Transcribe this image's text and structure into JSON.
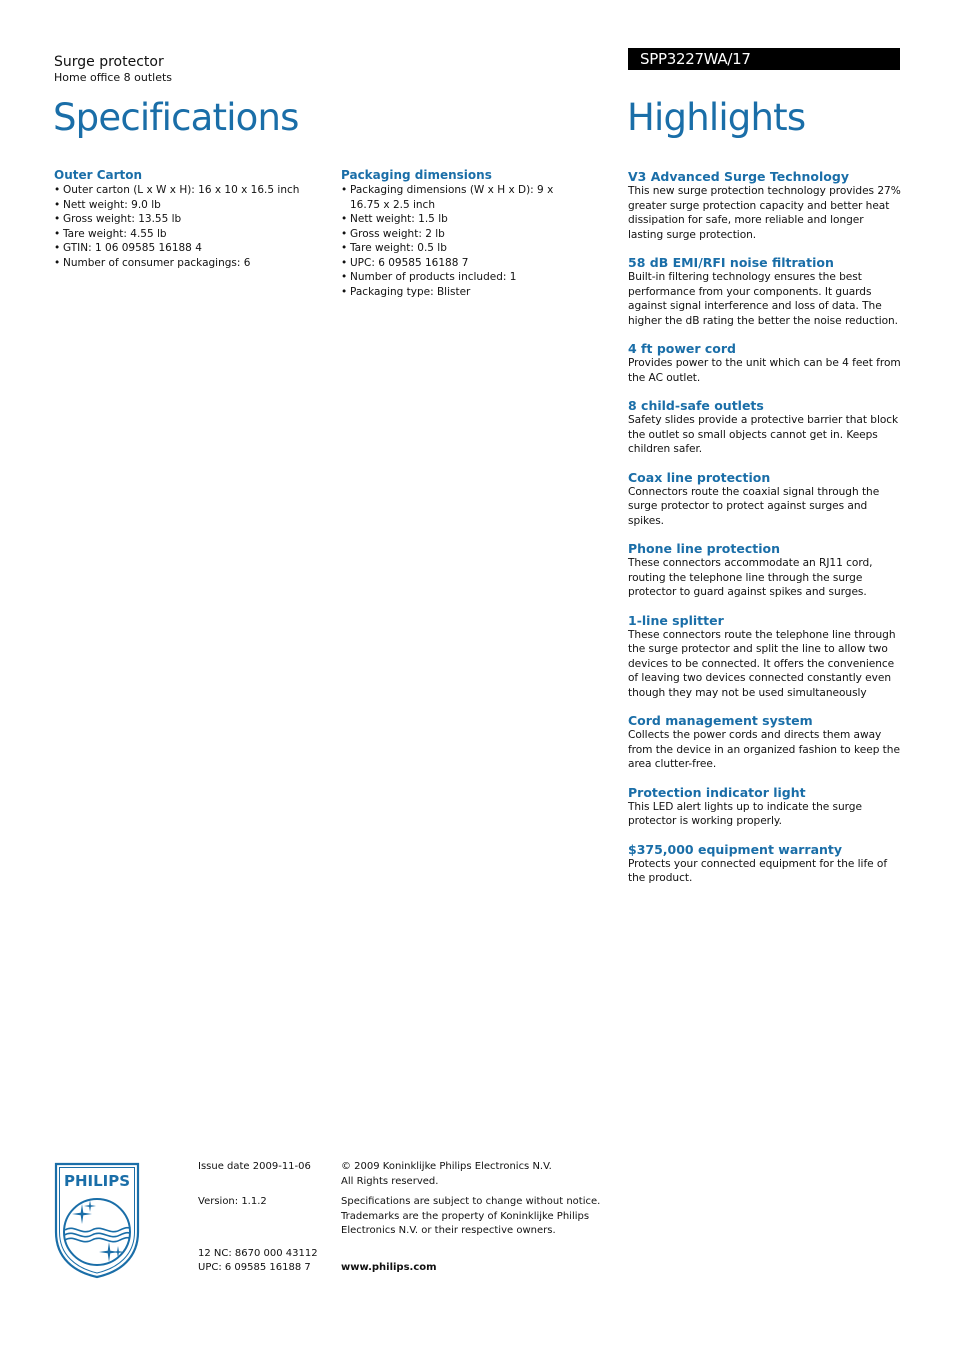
{
  "header": {
    "product_title": "Surge protector",
    "product_subtitle": "Home office 8 outlets",
    "model_number": "SPP3227WA/17",
    "specifications_heading": "Specifications",
    "highlights_heading": "Highlights"
  },
  "colors": {
    "accent_blue": "#1a6ea8",
    "model_bar_bg": "#000000",
    "model_bar_text": "#ffffff"
  },
  "specifications": {
    "outer_carton": {
      "title": "Outer Carton",
      "items": [
        "Outer carton (L x W x H): 16 x 10 x 16.5 inch",
        "Nett weight: 9.0 lb",
        "Gross weight: 13.55 lb",
        "Tare weight: 4.55 lb",
        "GTIN: 1 06 09585 16188 4",
        "Number of consumer packagings: 6"
      ]
    },
    "packaging_dimensions": {
      "title": "Packaging dimensions",
      "items": [
        "Packaging dimensions (W x H x D): 9 x 16.75 x 2.5 inch",
        "Nett weight: 1.5 lb",
        "Gross weight: 2 lb",
        "Tare weight: 0.5 lb",
        "UPC: 6 09585 16188 7",
        "Number of products included: 1",
        "Packaging type: Blister"
      ]
    }
  },
  "highlights": [
    {
      "title": "V3 Advanced Surge Technology",
      "description": "This new surge protection technology provides 27% greater surge protection capacity and better heat dissipation for safe, more reliable and longer lasting surge protection."
    },
    {
      "title": "58 dB EMI/RFI noise filtration",
      "description": "Built-in filtering technology ensures the best performance from your components. It guards against signal interference and loss of data. The higher the dB rating the better the noise reduction."
    },
    {
      "title": "4 ft power cord",
      "description": "Provides power to the unit which can be 4 feet from the AC outlet."
    },
    {
      "title": "8 child-safe outlets",
      "description": "Safety slides provide a protective barrier that block the outlet so small objects cannot get in. Keeps children safer."
    },
    {
      "title": "Coax line protection",
      "description": "Connectors route the coaxial signal through the surge protector to protect against surges and spikes."
    },
    {
      "title": "Phone line protection",
      "description": "These connectors accommodate an RJ11 cord, routing the telephone line through the surge protector to guard against spikes and surges."
    },
    {
      "title": "1-line splitter",
      "description": "These connectors route the telephone line through the surge protector and split the line to allow two devices to be connected. It offers the convenience of leaving two devices connected constantly even though they may not be used simultaneously"
    },
    {
      "title": "Cord management system",
      "description": "Collects the power cords and directs them away from the device in an organized fashion to keep the area clutter-free."
    },
    {
      "title": "Protection indicator light",
      "description": "This LED alert lights up to indicate the surge protector is working properly."
    },
    {
      "title": "$375,000 equipment warranty",
      "description": "Protects your connected equipment for the life of the product."
    }
  ],
  "footer": {
    "logo_text": "PHILIPS",
    "issue_date": "Issue date 2009-11-06",
    "version": "Version: 1.1.2",
    "nc": "12 NC: 8670 000 43112",
    "upc": "UPC: 6 09585 16188 7",
    "copyright_line1": "© 2009 Koninklijke Philips Electronics N.V.",
    "copyright_line2": "All Rights reserved.",
    "disclaimer": "Specifications are subject to change without notice. Trademarks are the property of Koninklijke Philips Electronics N.V. or their respective owners.",
    "website": "www.philips.com"
  }
}
